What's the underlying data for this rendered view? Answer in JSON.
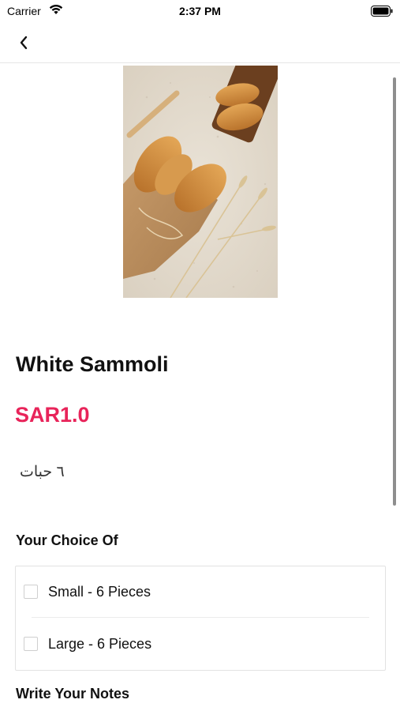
{
  "status_bar": {
    "carrier": "Carrier",
    "time": "2:37 PM"
  },
  "nav": {
    "back_icon": "chevron-left-icon"
  },
  "product": {
    "title": "White Sammoli",
    "price": "SAR1.0",
    "description": "٦ حبات"
  },
  "choices": {
    "heading": "Your Choice Of",
    "options": [
      {
        "label": "Small - 6 Pieces",
        "checked": false
      },
      {
        "label": "Large - 6 Pieces",
        "checked": false
      }
    ]
  },
  "notes": {
    "heading": "Write Your Notes"
  },
  "colors": {
    "price": "#e8245a",
    "background": "#ffffff"
  }
}
